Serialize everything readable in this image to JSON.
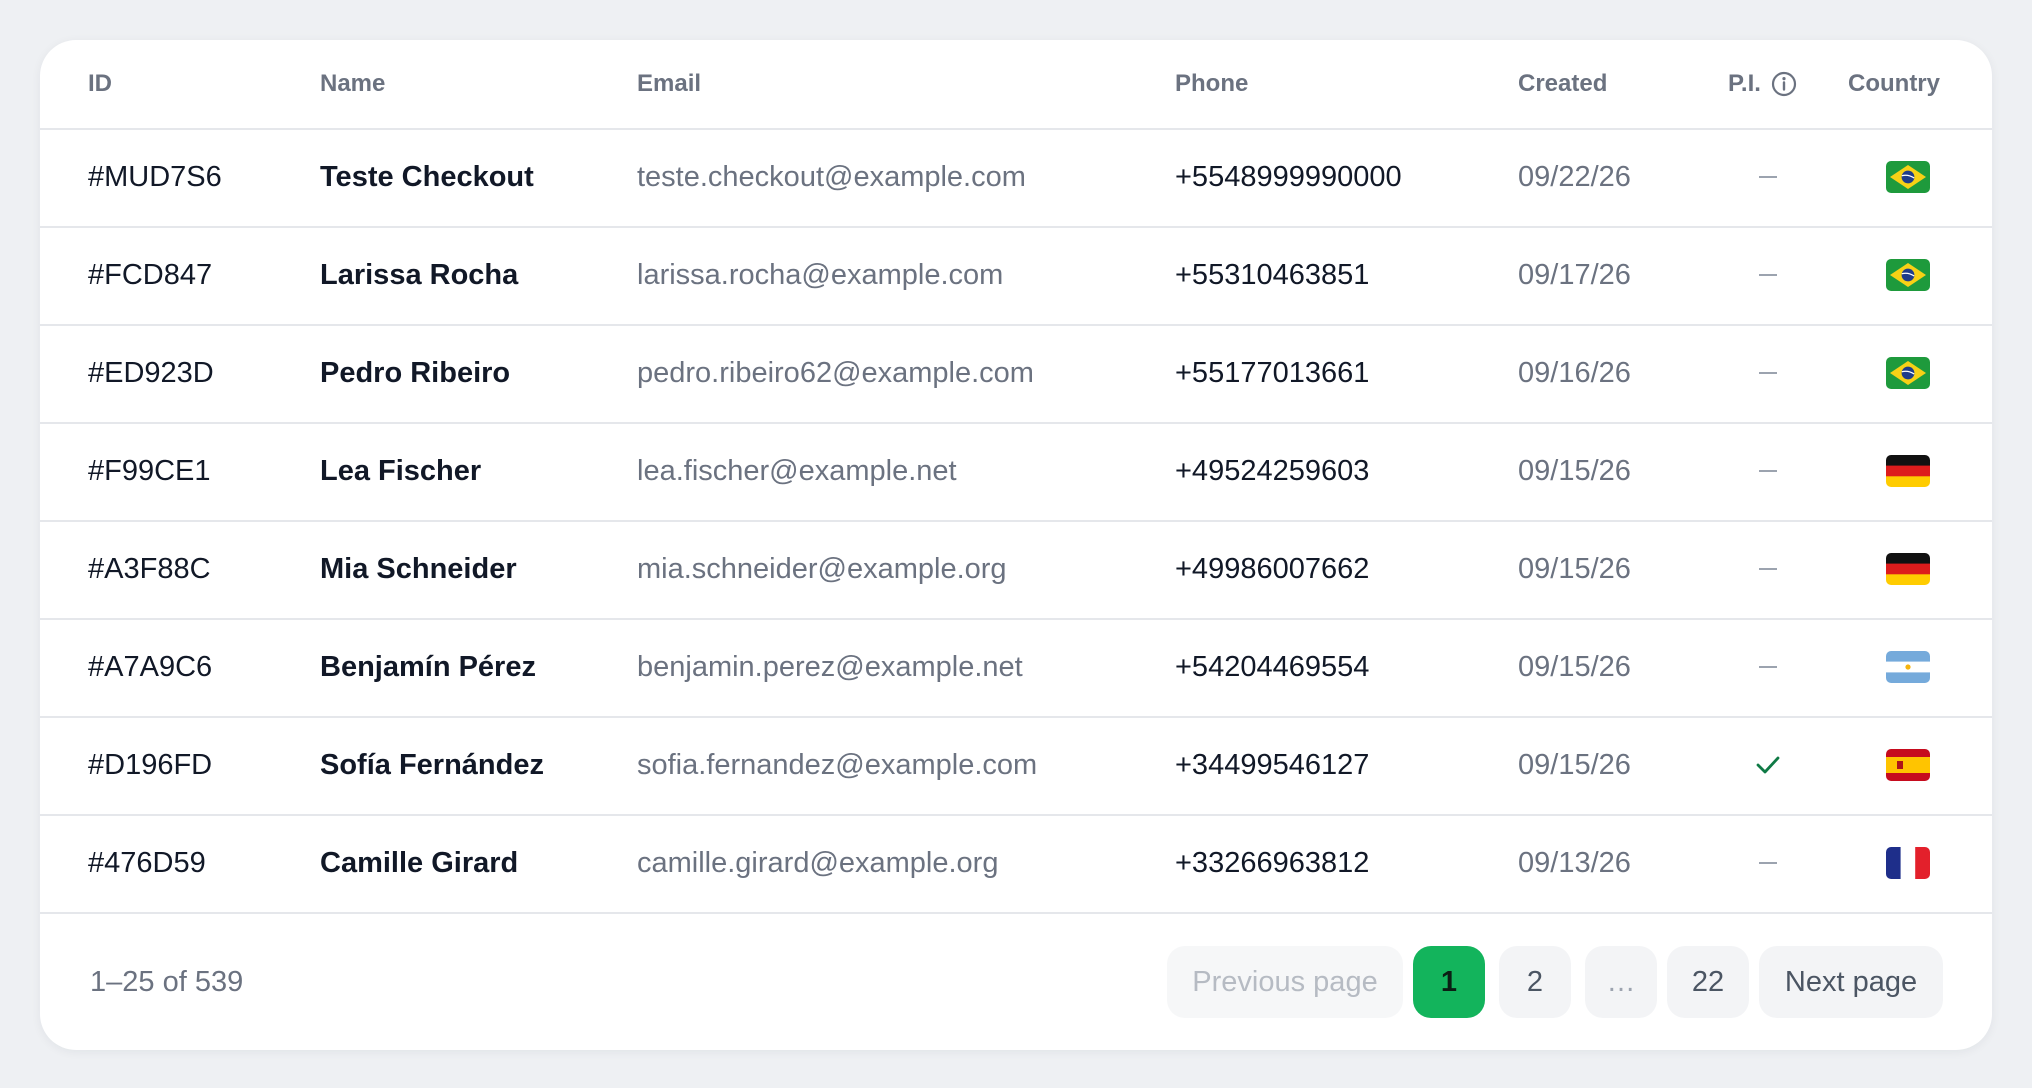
{
  "table": {
    "columns": {
      "id": "ID",
      "name": "Name",
      "email": "Email",
      "phone": "Phone",
      "created": "Created",
      "pi": "P.I.",
      "country": "Country"
    },
    "rows": [
      {
        "id": "#MUD7S6",
        "name": "Teste Checkout",
        "email": "teste.checkout@example.com",
        "phone": "+5548999990000",
        "created": "09/22/26",
        "pi": false,
        "country": "BR"
      },
      {
        "id": "#FCD847",
        "name": "Larissa Rocha",
        "email": "larissa.rocha@example.com",
        "phone": "+55310463851",
        "created": "09/17/26",
        "pi": false,
        "country": "BR"
      },
      {
        "id": "#ED923D",
        "name": "Pedro Ribeiro",
        "email": "pedro.ribeiro62@example.com",
        "phone": "+55177013661",
        "created": "09/16/26",
        "pi": false,
        "country": "BR"
      },
      {
        "id": "#F99CE1",
        "name": "Lea Fischer",
        "email": "lea.fischer@example.net",
        "phone": "+49524259603",
        "created": "09/15/26",
        "pi": false,
        "country": "DE"
      },
      {
        "id": "#A3F88C",
        "name": "Mia Schneider",
        "email": "mia.schneider@example.org",
        "phone": "+49986007662",
        "created": "09/15/26",
        "pi": false,
        "country": "DE"
      },
      {
        "id": "#A7A9C6",
        "name": "Benjamín Pérez",
        "email": "benjamin.perez@example.net",
        "phone": "+54204469554",
        "created": "09/15/26",
        "pi": false,
        "country": "AR"
      },
      {
        "id": "#D196FD",
        "name": "Sofía Fernández",
        "email": "sofia.fernandez@example.com",
        "phone": "+34499546127",
        "created": "09/15/26",
        "pi": true,
        "country": "ES"
      },
      {
        "id": "#476D59",
        "name": "Camille Girard",
        "email": "camille.girard@example.org",
        "phone": "+33266963812",
        "created": "09/13/26",
        "pi": false,
        "country": "FR"
      }
    ]
  },
  "footer": {
    "range": "1–25 of 539",
    "previous_label": "Previous page",
    "next_label": "Next page",
    "pages": [
      "1",
      "2",
      "…",
      "22"
    ],
    "current_page": "1"
  },
  "colors": {
    "accent": "#13b45c",
    "check": "#0f7a45"
  },
  "icons": {
    "pi_info": "info-icon",
    "pi_yes": "check-icon",
    "pi_no": "dash"
  }
}
